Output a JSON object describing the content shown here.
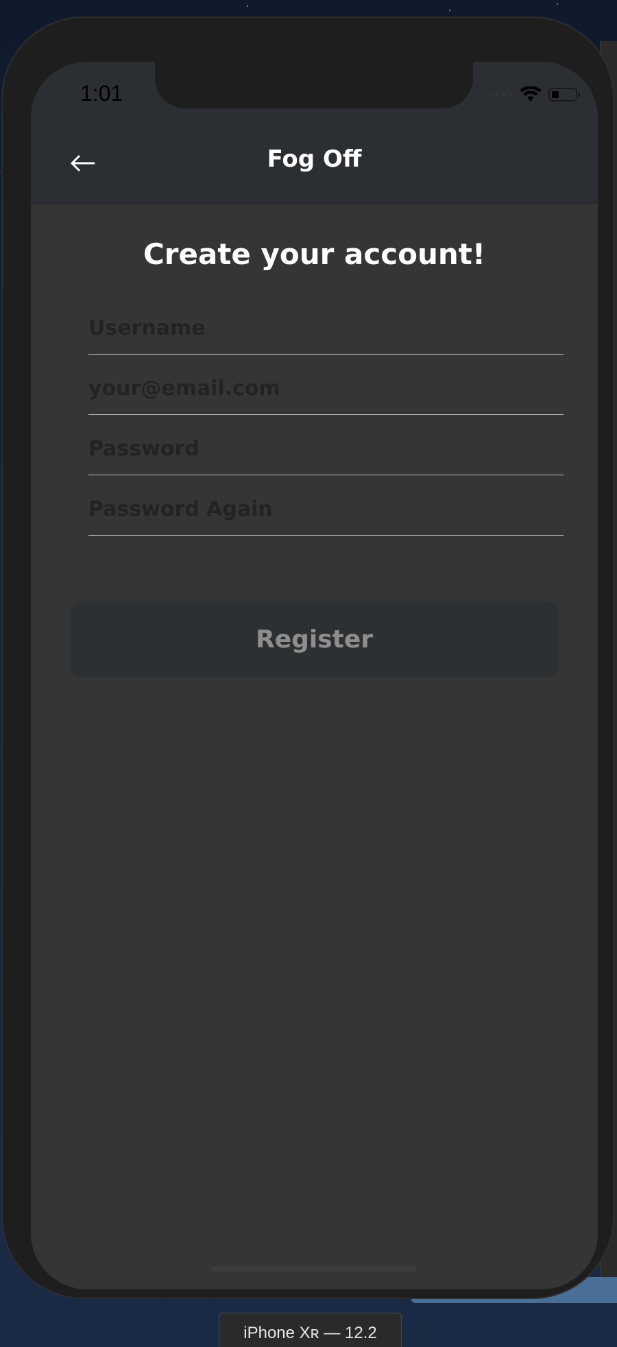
{
  "status_bar": {
    "time": "1:01",
    "battery_level": 0.3
  },
  "nav_bar": {
    "title": "Fog Off",
    "back_icon": "arrow-left-icon"
  },
  "form": {
    "heading": "Create your account!",
    "fields": [
      {
        "placeholder": "Username",
        "value": ""
      },
      {
        "placeholder": "your@email.com",
        "value": ""
      },
      {
        "placeholder": "Password",
        "value": ""
      },
      {
        "placeholder": "Password Again",
        "value": ""
      }
    ],
    "register_label": "Register"
  },
  "simulator": {
    "device_label": "iPhone Xʀ — 12.2"
  },
  "colors": {
    "screen_background": "#353535",
    "nav_background": "#2b2e32",
    "button_background": "#2d3033",
    "button_text": "#8e8e8e",
    "placeholder_text": "#232323",
    "field_underline": "#bdbdbd",
    "title_text": "#ffffff"
  }
}
